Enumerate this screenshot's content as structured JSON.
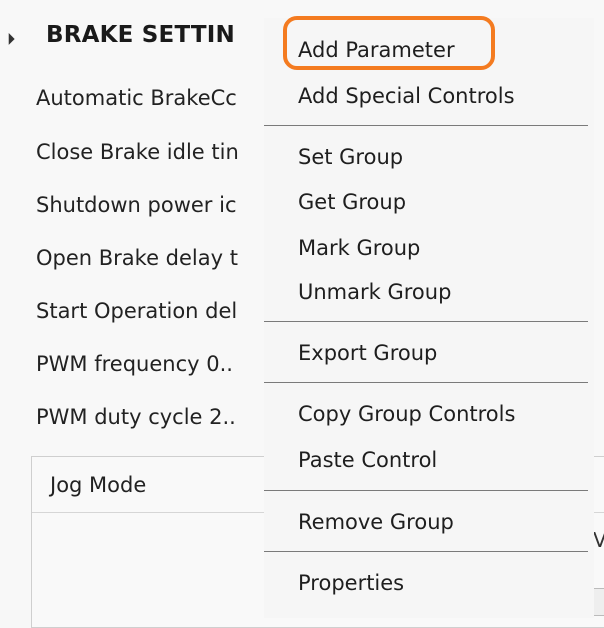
{
  "section": {
    "title": "BRAKE SETTIN",
    "parameters": [
      "Automatic BrakeCc",
      "Close Brake idle tin",
      "Shutdown power ic",
      "Open Brake delay t",
      "Start Operation del",
      "PWM frequency 0..",
      "PWM duty cycle 2.."
    ]
  },
  "jog": {
    "title": "Jog Mode",
    "peek_text": "V"
  },
  "context_menu": {
    "items": [
      "Add Parameter",
      "Add Special Controls",
      "Set Group",
      "Get Group",
      "Mark Group",
      "Unmark Group",
      "Export Group",
      "Copy Group Controls",
      "Paste Control",
      "Remove Group",
      "Properties"
    ],
    "highlighted_item": "Add Parameter",
    "highlight_color": "#f47b20"
  }
}
